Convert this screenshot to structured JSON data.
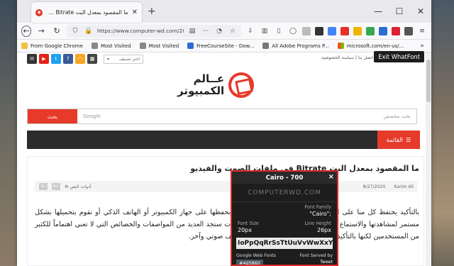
{
  "tab": {
    "title": "ما المقصود بمعدل البت Bitrate ..."
  },
  "nav": {
    "url": "https://www.computer-wd.com/2020/..."
  },
  "bookmarks": [
    "From Google Chrome",
    "Most Visited",
    "Most Visited",
    "FreeCourseSite - Dow...",
    "All Adobe Programs P...",
    "microsoft.com/en-us/..."
  ],
  "site": {
    "theme_select": "اختر تصنيف",
    "top_links": "اتصل بنا | سياسة الخصوصية",
    "exit_whatfont": "Exit WhatFont",
    "logo_line1": "عــالم",
    "logo_line2": "الكمبيوتر",
    "search_button": "بحث",
    "search_placeholder": "بحث مخصص",
    "search_brand": "Google",
    "menu_label": "القائمة"
  },
  "article": {
    "title": "ما المقصود بمعدل البت Bitrate في ملفات الصوت والفيديو",
    "author": "Karim Ali",
    "date": "8/27/2020",
    "settings": "أدوات النص",
    "body": "بالتأكيد يحتفظ كل منا على الأقل ببعض مقاطع الفيديو التي نقوم بحفظها على جهاز الكمبيوتر أو الهاتف الذكي أو نقوم بتحميلها بشكل مستمر لمشاهدتها والاستماع إليها بشكل مباشر، وبفحص تلك الملفات ستجد العديد من المواصفات والخصائص التي لا تعني اهتماماً للكثير من المستخدمين لكنها بالتأكيد تمثل فارقاً كبيراً بين ملف فيديو أو ملف صوتي وآخر."
  },
  "whatfont": {
    "title": "Cairo - 700",
    "sample": "COMPUTERWD.COM",
    "font_family_label": "Font Family",
    "font_family_value": "\"Cairo\";",
    "font_size_label": "Font Size",
    "font_size_value": "20px",
    "line_height_label": "Line Height",
    "line_height_value": "26px",
    "glyphs": "IoPpQqRrSsTtUuVvWwXxYyZz",
    "served_label": "Google Web Fonts",
    "served_by": "Font Served by",
    "color": "#4d5860",
    "tweet": "Tweet"
  }
}
